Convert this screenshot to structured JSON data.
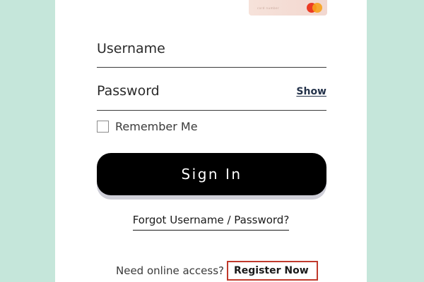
{
  "card_art": {
    "text": "card number",
    "logo_icon": "mastercard-logo"
  },
  "login": {
    "username_label": "Username",
    "password_label": "Password",
    "show_label": "Show",
    "remember_label": "Remember Me",
    "remember_checked": false,
    "signin_label": "Sign In",
    "forgot_label": "Forgot Username / Password?"
  },
  "register": {
    "prompt": "Need online access?",
    "link_label": "Register Now",
    "highlight_color": "#c0392b"
  },
  "colors": {
    "background": "#c5e6da",
    "card": "#ffffff",
    "button": "#000000",
    "button_text": "#ffffff"
  }
}
